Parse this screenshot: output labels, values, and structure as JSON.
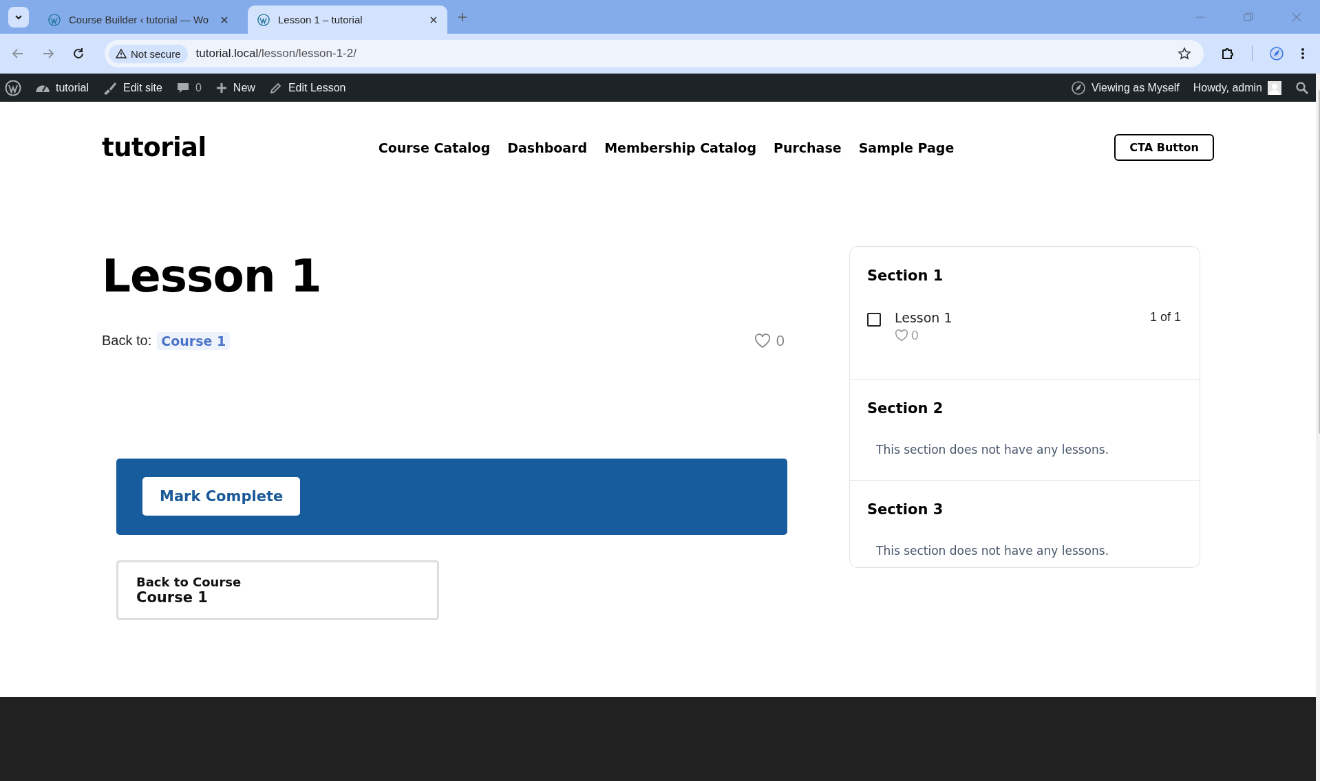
{
  "browser": {
    "tabs": [
      {
        "title": "Course Builder ‹ tutorial — Wo",
        "selected": false
      },
      {
        "title": "Lesson 1 – tutorial",
        "selected": true
      }
    ],
    "address": {
      "security": "Not secure",
      "host": "tutorial.local",
      "path": "/lesson/lesson-1-2/"
    }
  },
  "admin_bar": {
    "left": [
      {
        "kind": "site",
        "label": "tutorial"
      },
      {
        "kind": "edit-site",
        "label": "Edit site"
      },
      {
        "kind": "comments",
        "label": "0"
      },
      {
        "kind": "new",
        "label": "New"
      },
      {
        "kind": "edit",
        "label": "Edit Lesson"
      }
    ],
    "right": [
      {
        "kind": "viewing",
        "label": "Viewing as Myself"
      },
      {
        "kind": "user",
        "label": "Howdy, admin"
      }
    ]
  },
  "site": {
    "logo": "tutorial",
    "nav": [
      "Course Catalog",
      "Dashboard",
      "Membership Catalog",
      "Purchase",
      "Sample Page"
    ],
    "cta": "CTA Button"
  },
  "lesson": {
    "title": "Lesson 1",
    "back_to_label": "Back to:",
    "back_to_link": "Course 1",
    "likes": "0",
    "mark_complete": "Mark Complete",
    "back_card": {
      "label": "Back to Course",
      "course": "Course 1"
    }
  },
  "sidebar": {
    "sections": [
      {
        "title": "Section 1",
        "lessons": [
          {
            "title": "Lesson 1",
            "checked": false,
            "likes": "0",
            "position": "1 of 1"
          }
        ]
      },
      {
        "title": "Section 2",
        "empty_text": "This section does not have any lessons."
      },
      {
        "title": "Section 3",
        "empty_text": "This section does not have any lessons."
      }
    ]
  },
  "footer": {
    "kind": "dark"
  }
}
